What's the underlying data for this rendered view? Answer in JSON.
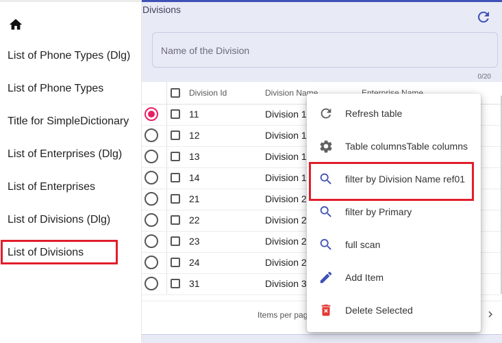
{
  "sidebar": {
    "items": [
      {
        "label": "List of Phone Types (Dlg)"
      },
      {
        "label": "List of Phone Types"
      },
      {
        "label": "Title for SimpleDictionary"
      },
      {
        "label": "List of Enterprises (Dlg)"
      },
      {
        "label": "List of Enterprises"
      },
      {
        "label": "List of Divisions (Dlg)"
      },
      {
        "label": "List of Divisions"
      }
    ]
  },
  "header": {
    "title": "Divisions",
    "search_placeholder": "Name of the Division",
    "counter": "0/20"
  },
  "table": {
    "columns": [
      "Division Id",
      "Division Name",
      "Enterprise Name"
    ],
    "rows": [
      {
        "id": "11",
        "name": "Division 1",
        "selected": true
      },
      {
        "id": "12",
        "name": "Division 1",
        "selected": false
      },
      {
        "id": "13",
        "name": "Division 1",
        "selected": false
      },
      {
        "id": "14",
        "name": "Division 1",
        "selected": false
      },
      {
        "id": "21",
        "name": "Division 2",
        "selected": false
      },
      {
        "id": "22",
        "name": "Division 2",
        "selected": false
      },
      {
        "id": "23",
        "name": "Division 2",
        "selected": false
      },
      {
        "id": "24",
        "name": "Division 2",
        "selected": false
      },
      {
        "id": "31",
        "name": "Division 3",
        "selected": false
      }
    ]
  },
  "footer": {
    "items_per_page": "Items per page"
  },
  "menu": {
    "items": [
      {
        "label": "Refresh table",
        "icon": "refresh-icon"
      },
      {
        "label": "Table columnsTable columns",
        "icon": "gear-icon"
      },
      {
        "label": "filter by Division Name ref01",
        "icon": "search-icon"
      },
      {
        "label": "filter by Primary",
        "icon": "search-icon"
      },
      {
        "label": "full scan",
        "icon": "search-icon"
      },
      {
        "label": "Add Item",
        "icon": "pencil-icon"
      },
      {
        "label": "Delete Selected",
        "icon": "trash-icon"
      }
    ]
  },
  "colors": {
    "primary": "#3f51b5",
    "accent": "#e91e63",
    "highlight": "#e21d2a",
    "header_bg": "#e8eaf6",
    "delete": "#e53935"
  }
}
